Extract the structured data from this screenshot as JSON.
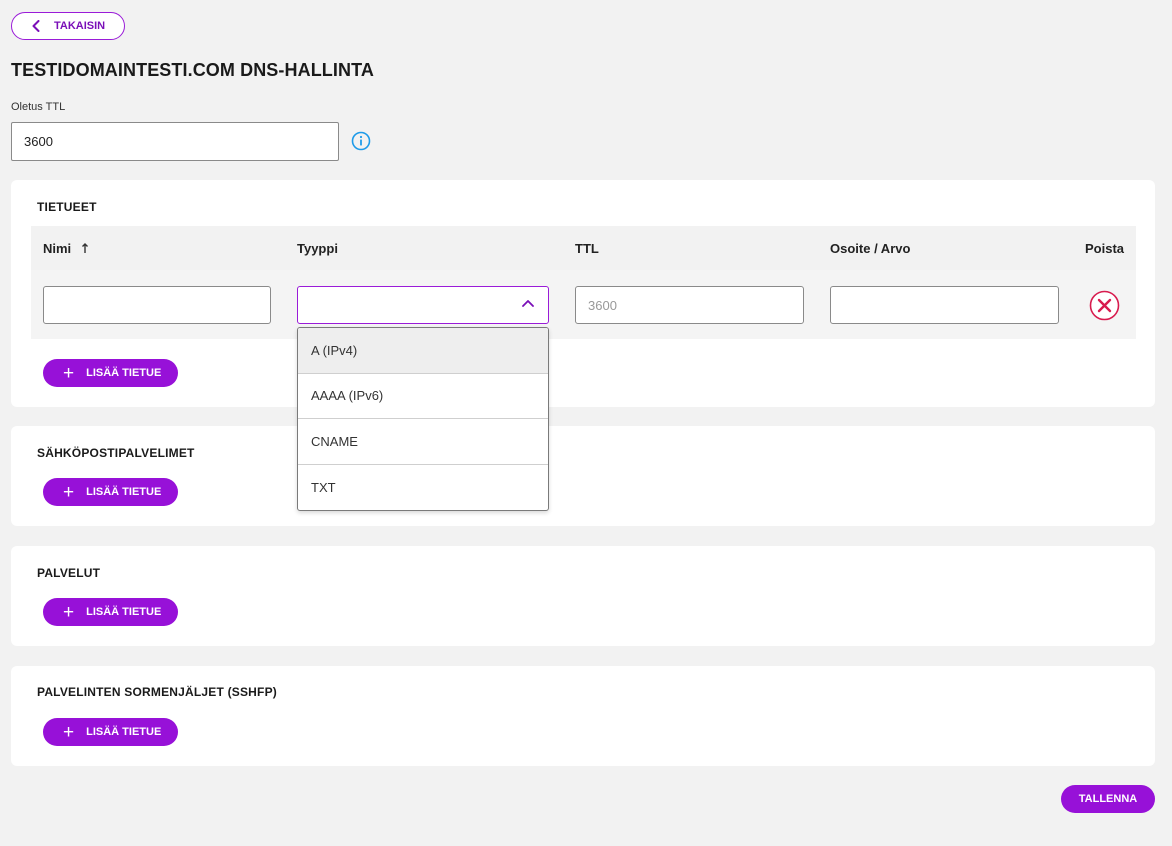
{
  "back_label": "TAKAISIN",
  "page_title": "TESTIDOMAINTESTI.COM DNS-HALLINTA",
  "default_ttl": {
    "label": "Oletus TTL",
    "value": "3600"
  },
  "records": {
    "title": "TIETUEET",
    "columns": {
      "name": "Nimi",
      "type": "Tyyppi",
      "ttl": "TTL",
      "address": "Osoite / Arvo",
      "delete": "Poista"
    },
    "row": {
      "name": "",
      "type": "",
      "ttl_placeholder": "3600",
      "address": ""
    },
    "add_label": "LISÄÄ TIETUE"
  },
  "type_dropdown": {
    "options": [
      "A (IPv4)",
      "AAAA (IPv6)",
      "CNAME",
      "TXT"
    ],
    "highlighted": "A (IPv4)"
  },
  "mail_servers": {
    "title": "SÄHKÖPOSTIPALVELIMET",
    "add_label": "LISÄÄ TIETUE"
  },
  "services": {
    "title": "PALVELUT",
    "add_label": "LISÄÄ TIETUE"
  },
  "sshfp": {
    "title": "PALVELINTEN SORMENJÄLJET (SSHFP)",
    "add_label": "LISÄÄ TIETUE"
  },
  "save_label": "TALLENNA",
  "colors": {
    "accent": "#9711d8",
    "delete": "#d81b4e",
    "info": "#1e9be9",
    "background": "#f2f2f2"
  }
}
